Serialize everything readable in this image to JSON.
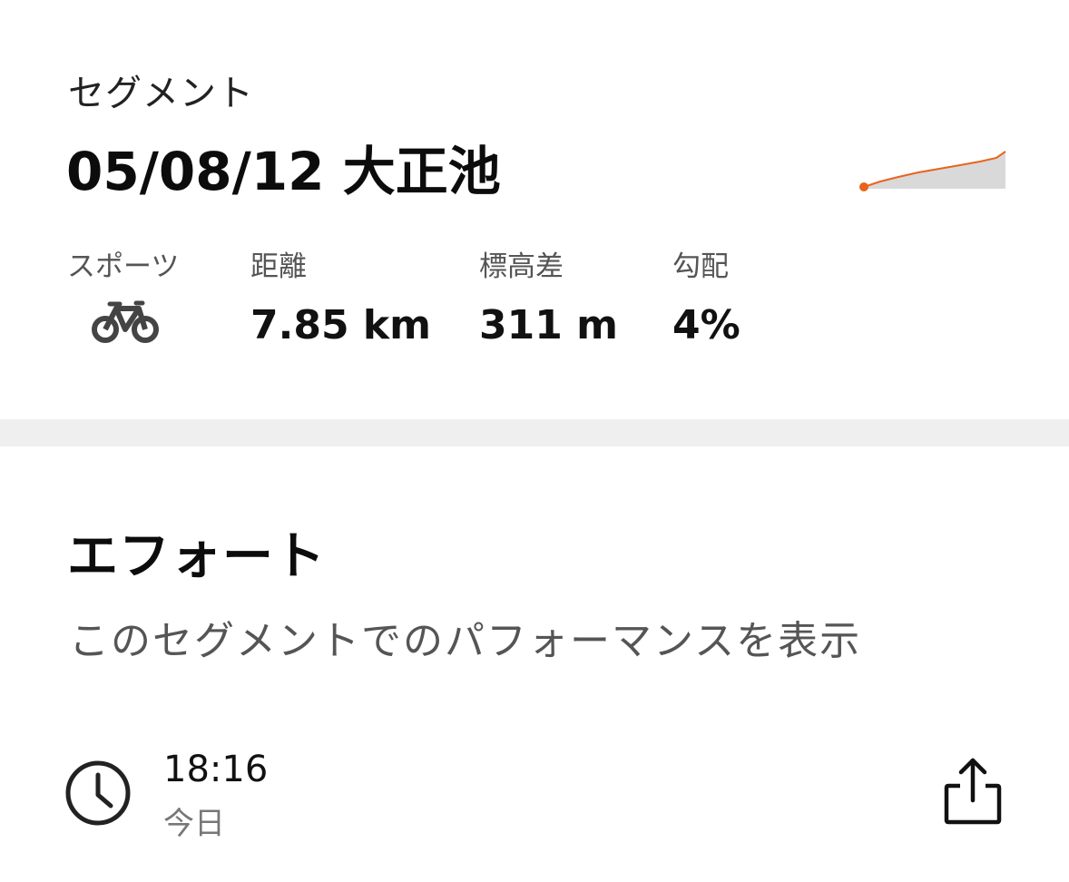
{
  "segment": {
    "label": "セグメント",
    "title": "05/08/12 大正池",
    "elevation_profile": {
      "line_color": "#e8641c",
      "fill_color": "#d9d9d9",
      "start_marker_color": "#e8641c",
      "trend": "gradual-climb"
    }
  },
  "stats": {
    "sport": {
      "label": "スポーツ",
      "icon": "bicycle-icon"
    },
    "distance": {
      "label": "距離",
      "value": "7.85 km"
    },
    "elevation_gain": {
      "label": "標高差",
      "value": "311 m"
    },
    "grade": {
      "label": "勾配",
      "value": "4%"
    }
  },
  "effort": {
    "title": "エフォート",
    "description": "このセグメントでのパフォーマンスを表示",
    "time": "18:16",
    "date": "今日",
    "clock_icon": "clock-icon",
    "share_icon": "share-icon"
  },
  "colors": {
    "accent": "#e8641c",
    "divider": "#efefef",
    "text_primary": "#111111",
    "text_secondary": "#555555"
  }
}
